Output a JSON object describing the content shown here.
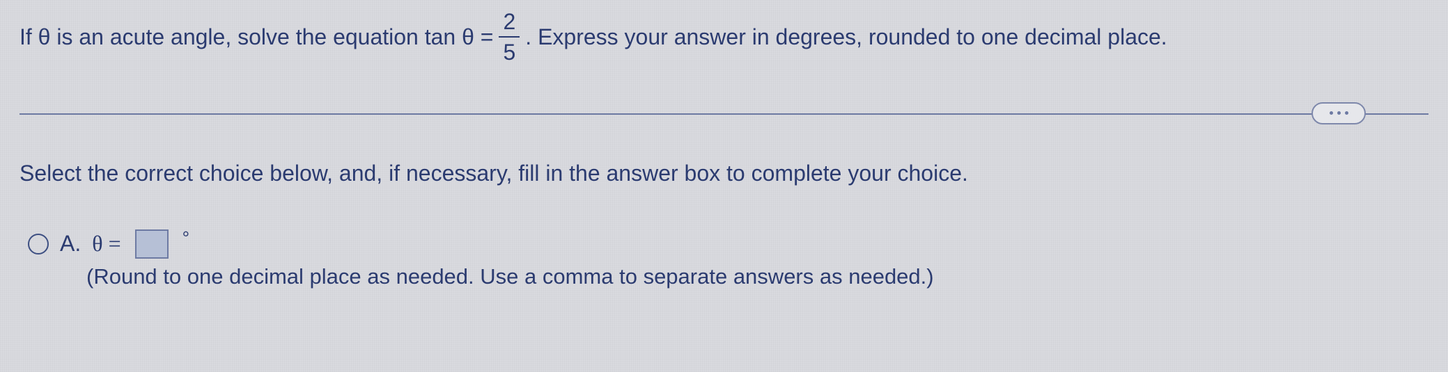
{
  "question": {
    "leading_text": "If θ is an acute angle, solve the equation tan θ = ",
    "fraction": {
      "numerator": "2",
      "denominator": "5"
    },
    "trailing_text": ". Express your answer in degrees, rounded to one decimal place."
  },
  "instruction": "Select the correct choice below, and, if necessary, fill in the answer box to complete your choice.",
  "choices": {
    "a": {
      "label": "A.",
      "prefix": "θ =",
      "input_value": "",
      "unit": "°",
      "hint": "(Round to one decimal place as needed. Use a comma to separate answers as needed.)"
    }
  },
  "icons": {
    "ellipsis": "more-options"
  }
}
